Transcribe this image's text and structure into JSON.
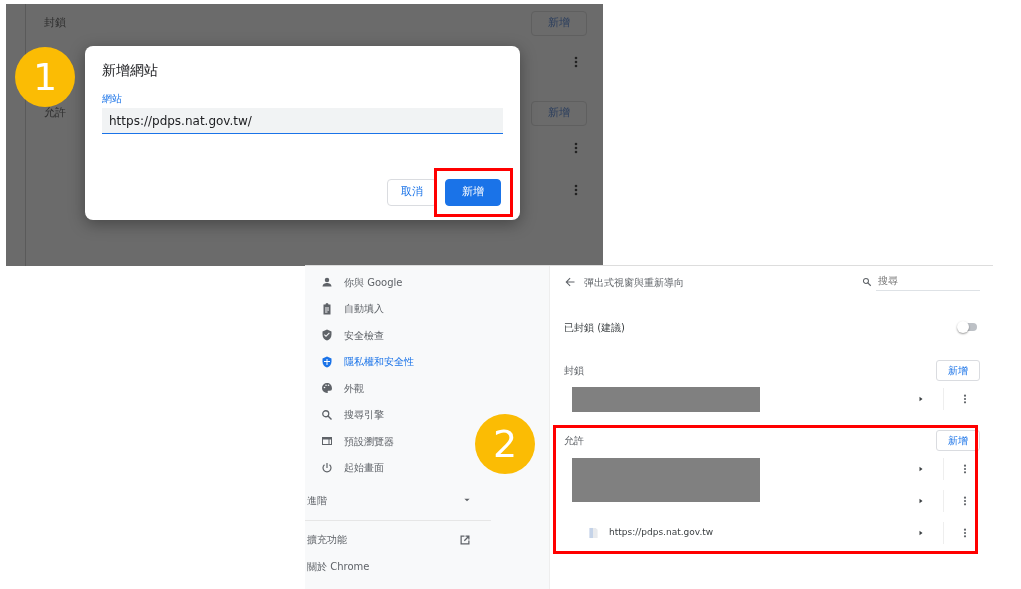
{
  "step_one": {
    "marker": "1",
    "background": {
      "sections": [
        {
          "title": "封鎖",
          "add_button": "新增",
          "rows": [
            {
              "kind": "covered"
            }
          ]
        },
        {
          "title": "允許",
          "add_button": "新增",
          "rows": [
            {
              "kind": "covered"
            },
            {
              "kind": "covered"
            }
          ]
        }
      ]
    },
    "dialog": {
      "title": "新增網站",
      "field": {
        "label": "網站",
        "value": "https://pdps.nat.gov.tw/"
      },
      "buttons": [
        {
          "label": "取消",
          "kind": "secondary",
          "highlighted": false
        },
        {
          "label": "新增",
          "kind": "primary",
          "highlighted": true
        }
      ]
    }
  },
  "step_two": {
    "marker": "2",
    "sidebar": {
      "items": [
        {
          "label": "你與 Google",
          "selected": false
        },
        {
          "label": "自動填入",
          "selected": false
        },
        {
          "label": "安全檢查",
          "selected": false
        },
        {
          "label": "隱私權和安全性",
          "selected": true
        },
        {
          "label": "外觀",
          "selected": false
        },
        {
          "label": "搜尋引擎",
          "selected": false
        },
        {
          "label": "預設瀏覽器",
          "selected": false
        },
        {
          "label": "起始畫面",
          "selected": false
        }
      ],
      "advanced": {
        "label": "進階",
        "expanded": false
      },
      "links": [
        {
          "label": "擴充功能",
          "external": true
        },
        {
          "label": "關於 Chrome",
          "external": false
        }
      ]
    },
    "main": {
      "title": "彈出式視窗與重新導向",
      "search": {
        "placeholder": "搜尋"
      },
      "toggle": {
        "label": "已封鎖 (建議)",
        "on": false
      },
      "sections": [
        {
          "title": "封鎖",
          "add_button": "新增",
          "highlighted": false,
          "rows": [
            {
              "kind": "redacted"
            }
          ]
        },
        {
          "title": "允許",
          "add_button": "新增",
          "highlighted": true,
          "rows": [
            {
              "kind": "redacted"
            },
            {
              "kind": "redacted"
            },
            {
              "kind": "site",
              "label": "https://pdps.nat.gov.tw"
            }
          ]
        }
      ]
    }
  }
}
